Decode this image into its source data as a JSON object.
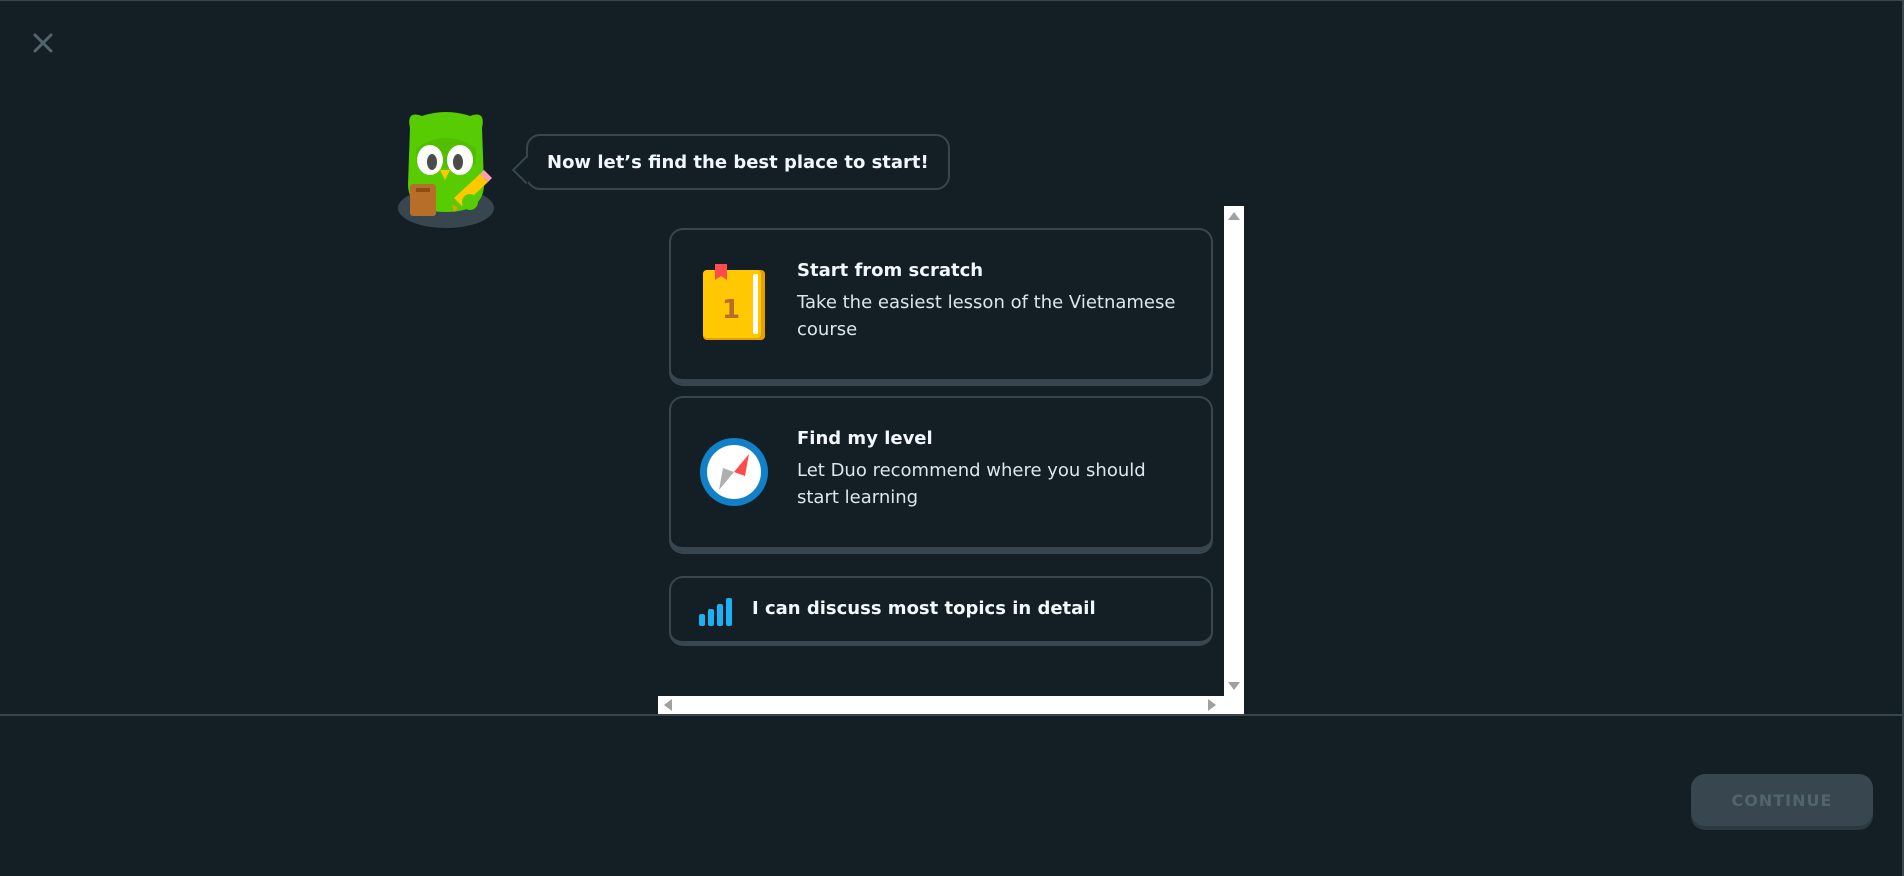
{
  "header": {
    "close_label": "×"
  },
  "mascot": {
    "speech": "Now let’s find the best place to start!"
  },
  "options": [
    {
      "title": "Start from scratch",
      "description": "Take the easiest lesson of the Vietnamese course",
      "icon": "book-icon",
      "book_number": "1"
    },
    {
      "title": "Find my level",
      "description": "Let Duo recommend where you should start learning",
      "icon": "compass-icon"
    }
  ],
  "proficiency": {
    "label": "I can discuss most topics in detail",
    "icon": "signal-bars-icon"
  },
  "footer": {
    "continue_label": "CONTINUE"
  },
  "colors": {
    "background": "#131f24",
    "border": "#37464f",
    "accent_blue": "#1cb0f6",
    "owl_green": "#58cc02"
  }
}
